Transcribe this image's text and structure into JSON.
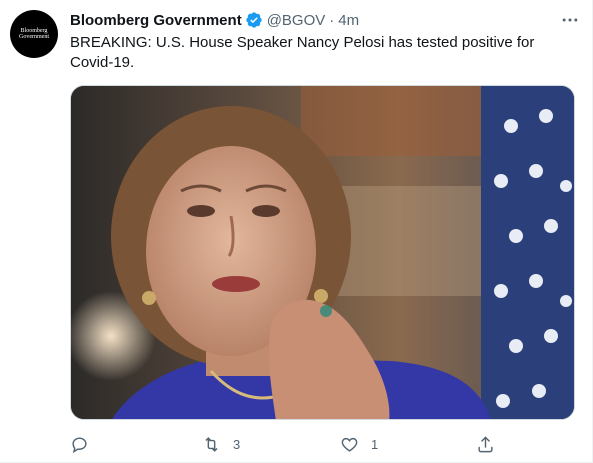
{
  "tweet": {
    "author": {
      "name": "Bloomberg Government",
      "handle": "@BGOV",
      "verified": true,
      "avatar_text_line1": "Bloomberg",
      "avatar_text_line2": "Government"
    },
    "separator": "·",
    "time": "4m",
    "text": "BREAKING: U.S. House Speaker Nancy Pelosi has tested positive for Covid-19.",
    "actions": {
      "reply_count": "",
      "retweet_count": "3",
      "like_count": "1"
    }
  },
  "icons": {
    "verified": "verified-badge-icon",
    "more": "more-options-icon",
    "reply": "reply-icon",
    "retweet": "retweet-icon",
    "like": "heart-icon",
    "share": "share-icon"
  },
  "colors": {
    "text_primary": "#0f1419",
    "text_secondary": "#536471",
    "verified_blue": "#1d9bf0",
    "border": "#cfd9de"
  }
}
